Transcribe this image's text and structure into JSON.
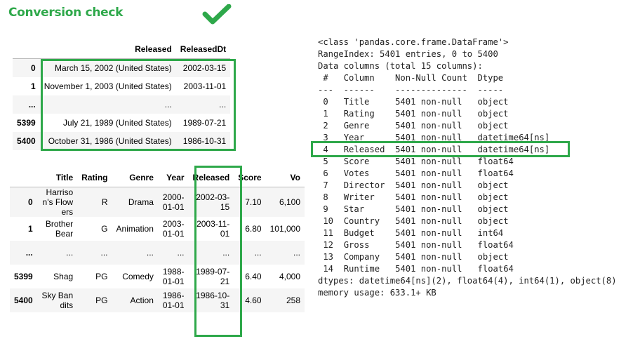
{
  "header": {
    "title": "Conversion check",
    "check_icon": "checkmark-icon",
    "accent": "#2ea84a"
  },
  "table1": {
    "columns": [
      "",
      "Released",
      "ReleasedDt"
    ],
    "rows": [
      [
        "0",
        "March 15, 2002 (United States)",
        "2002-03-15"
      ],
      [
        "1",
        "November 1, 2003 (United States)",
        "2003-11-01"
      ],
      [
        "...",
        "...",
        "..."
      ],
      [
        "5399",
        "July 21, 1989 (United States)",
        "1989-07-21"
      ],
      [
        "5400",
        "October 31, 1986 (United States)",
        "1986-10-31"
      ]
    ]
  },
  "table2": {
    "columns": [
      "",
      "Title",
      "Rating",
      "Genre",
      "Year",
      "Released",
      "Score",
      "Vo"
    ],
    "rows": [
      [
        "0",
        "Harrison's Flowers",
        "R",
        "Drama",
        "2000-01-01",
        "2002-03-15",
        "7.10",
        "6,100"
      ],
      [
        "1",
        "Brother Bear",
        "G",
        "Animation",
        "2003-01-01",
        "2003-11-01",
        "6.80",
        "101,000"
      ],
      [
        "...",
        "...",
        "...",
        "...",
        "...",
        "...",
        "...",
        "..."
      ],
      [
        "5399",
        "Shag",
        "PG",
        "Comedy",
        "1988-01-01",
        "1989-07-21",
        "6.40",
        "4,000"
      ],
      [
        "5400",
        "Sky Bandits",
        "PG",
        "Action",
        "1986-01-01",
        "1986-10-31",
        "4.60",
        "258"
      ]
    ]
  },
  "info": {
    "header_lines": [
      "<class 'pandas.core.frame.DataFrame'>",
      "RangeIndex: 5401 entries, 0 to 5400",
      "Data columns (total 15 columns):",
      " #   Column    Non-Null Count  Dtype",
      "---  ------    --------------  -----"
    ],
    "columns": [
      {
        "idx": "0",
        "name": "Title",
        "count": "5401 non-null",
        "dtype": "object"
      },
      {
        "idx": "1",
        "name": "Rating",
        "count": "5401 non-null",
        "dtype": "object"
      },
      {
        "idx": "2",
        "name": "Genre",
        "count": "5401 non-null",
        "dtype": "object"
      },
      {
        "idx": "3",
        "name": "Year",
        "count": "5401 non-null",
        "dtype": "datetime64[ns]"
      },
      {
        "idx": "4",
        "name": "Released",
        "count": "5401 non-null",
        "dtype": "datetime64[ns]"
      },
      {
        "idx": "5",
        "name": "Score",
        "count": "5401 non-null",
        "dtype": "float64"
      },
      {
        "idx": "6",
        "name": "Votes",
        "count": "5401 non-null",
        "dtype": "float64"
      },
      {
        "idx": "7",
        "name": "Director",
        "count": "5401 non-null",
        "dtype": "object"
      },
      {
        "idx": "8",
        "name": "Writer",
        "count": "5401 non-null",
        "dtype": "object"
      },
      {
        "idx": "9",
        "name": "Star",
        "count": "5401 non-null",
        "dtype": "object"
      },
      {
        "idx": "10",
        "name": "Country",
        "count": "5401 non-null",
        "dtype": "object"
      },
      {
        "idx": "11",
        "name": "Budget",
        "count": "5401 non-null",
        "dtype": "int64"
      },
      {
        "idx": "12",
        "name": "Gross",
        "count": "5401 non-null",
        "dtype": "float64"
      },
      {
        "idx": "13",
        "name": "Company",
        "count": "5401 non-null",
        "dtype": "object"
      },
      {
        "idx": "14",
        "name": "Runtime",
        "count": "5401 non-null",
        "dtype": "float64"
      }
    ],
    "footer_lines": [
      "dtypes: datetime64[ns](2), float64(4), int64(1), object(8)",
      "memory usage: 633.1+ KB"
    ]
  }
}
